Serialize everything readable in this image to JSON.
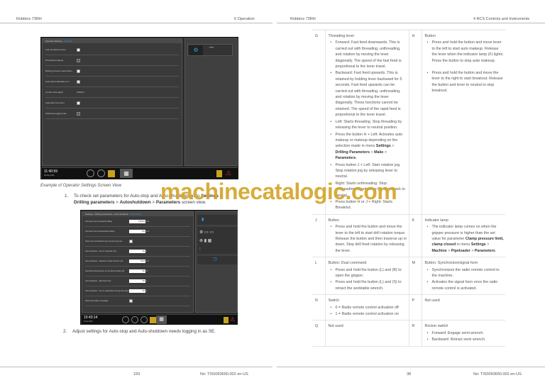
{
  "header": {
    "left_book": "Robbins 73RH",
    "left_section": "6 Operation",
    "right_book": "Robbins 73RH",
    "right_section": "4 RCS Controls and Instruments"
  },
  "screen1": {
    "title_prefix": "Operator Settings - ",
    "title_active": "Settings",
    "rows": [
      {
        "label": "Auto shutdown active",
        "checkbox": "white"
      },
      {
        "label": "Drivehead makeup",
        "checkbox": "off"
      },
      {
        "label": "Bolting pressure supervision",
        "checkbox": "white"
      },
      {
        "label": "Hole depth calculation on",
        "checkbox": "checked"
      },
      {
        "label": "Current hole depth",
        "value": "0.000 m"
      },
      {
        "label": "Automatic rod count",
        "checkbox": "white"
      },
      {
        "label": "Start/stop logging hole",
        "checkbox": "off"
      }
    ],
    "clock_time": "11:40:59",
    "clock_date": "28 May 2020"
  },
  "caption": "Example of Operator Settings Screen View",
  "step1": {
    "num": "1.",
    "text_a": "To check set parameters for Auto-stop and Auto-shutdown go to ",
    "b1": "Settings",
    "sep": " > ",
    "b2": "Drilling parameters",
    "b3": "Autoshutdown",
    "b4": "Parameters",
    "text_b": " screen view."
  },
  "screen2": {
    "title_prefix": "Settings - Drilling parameters - Auto shutdown - ",
    "title_active": "Parameters",
    "rows": [
      {
        "label": "Auto-stop limit at upwards drilling",
        "value": "1700.0",
        "unit": "mm"
      },
      {
        "label": "Auto-stop limit at downwards drilling",
        "value": "0.0",
        "unit": "mm"
      },
      {
        "label": "Store current drawdown pos as auto stop pos",
        "checkbox": "white"
      },
      {
        "label": "Auto shutdown - time to evacuate rock",
        "value": "30",
        "unit": "s"
      },
      {
        "label": "Auto shutdown - distance to back off from rock",
        "value": "50.0",
        "unit": "mm"
      },
      {
        "label": "Feed flow and pressure to use when backing off",
        "value": "50",
        "unit": "%"
      },
      {
        "label": "Auto shutdown - after flush time",
        "value": "60",
        "unit": "s"
      },
      {
        "label": "Auto shutdown - time to wait before turning off pumps",
        "value": "30",
        "unit": "s"
      },
      {
        "label": "Show information messages",
        "checkbox": "checked"
      }
    ],
    "clock_time": "10:43:14",
    "clock_date": "8 Jun 2020"
  },
  "step2": {
    "num": "2.",
    "text": "Adjust settings for Auto-stop and Auto-shutdown needs logging in as SE."
  },
  "watermark": "machinecatalogic.com",
  "table": {
    "G": {
      "key": "G",
      "title": "Threading lever",
      "items": [
        "Forward: Fast feed downwards. This is carried out with threading, unthreading, and rotation by moving the lever diagonally. The speed of the fast feed is proportional to the lever travel.",
        "Backward: Fast feed upwards. This is retained by holding lever backward for 5 seconds. Fast feed upwards can be carried out with threading, unthreading, and rotation by moving the lever diagonally. These functions cannot be retained. The speed of the rapid feed is proportional to the lever travel.",
        "Left: Starts threading. Stop threading by releasing the lever to neutral position.",
        "Press the button H + Left: Activates auto makeup or makeup depending on the selection made in menu ",
        "Press button J + Left: Start rotation jog. Stop rotation jog by releasing lever to neutral.",
        "Right: Starts unthreading. Stop unthreading by releasing the lever back to neutral.",
        "Press button H or J + Right: Starts Breakout."
      ],
      "menu_b1": "Settings",
      "menu_b2": "Drilling Parameters",
      "menu_b3": "Make",
      "menu_b4": "Parameters",
      "sep": " > "
    },
    "H": {
      "key": "H",
      "title": "Button",
      "items": [
        "Press and hold the button and move lever to the left to start auto makeup. Release the lever when the indicator lamp (F) lights. Press the button to stop auto makeup.",
        "Press and hold the button and move the lever to the right to start breakout. Release the button and lever to neutral to stop breakout."
      ]
    },
    "J": {
      "key": "J",
      "title": "Button",
      "items": [
        "Press and hold the button and move the lever to the left to start drill rotation torque. Release the button and then traverse up or down. Stop drill feed rotation by releasing the lever."
      ]
    },
    "K": {
      "key": "K",
      "title": "Indicator lamp",
      "text_a": "The indicator lamp comes on when the gripper pressure is higher than the set value for parameter ",
      "b1": "Clamp pressure limit, clamp closed",
      "text_b": " in menu ",
      "b2": "Settings",
      "b3": "Machine",
      "b4": "Pipeloader",
      "b5": "Parameters",
      "sep": " > "
    },
    "L": {
      "key": "L",
      "title": "Button: Dual command",
      "items": [
        "Press and hold the button (L) and (B) to open the gripper.",
        "Press and hold the button (L) and (S) to retract the worktable wrench."
      ]
    },
    "M": {
      "key": "M",
      "title": "Button: Synchronize/signal horn",
      "items": [
        "Synchronizes the radio remote control to the machine.",
        "Activates the signal horn once the radio remote control is activated."
      ]
    },
    "N": {
      "key": "N",
      "title": "Switch",
      "items": [
        "0 = Radio remote control activation off",
        "1 = Radio remote control activation on"
      ]
    },
    "P": {
      "key": "P",
      "title": "Not used"
    },
    "Q": {
      "key": "Q",
      "title": "Not used"
    },
    "R": {
      "key": "R",
      "title": "Rocker switch",
      "items": [
        "Forward: Engage semi wrench.",
        "Backward: Retract semi wrench."
      ]
    }
  },
  "footer": {
    "left_page": "159",
    "left_doc": "No: TIS0093650.002 en-US",
    "right_page": "38",
    "right_doc": "No: TIS0093650.002 en-US"
  },
  "colors": {
    "accent": "#2aa0e0",
    "watermark": "#d4a62a",
    "screen_bg": "#2c2c2c"
  }
}
